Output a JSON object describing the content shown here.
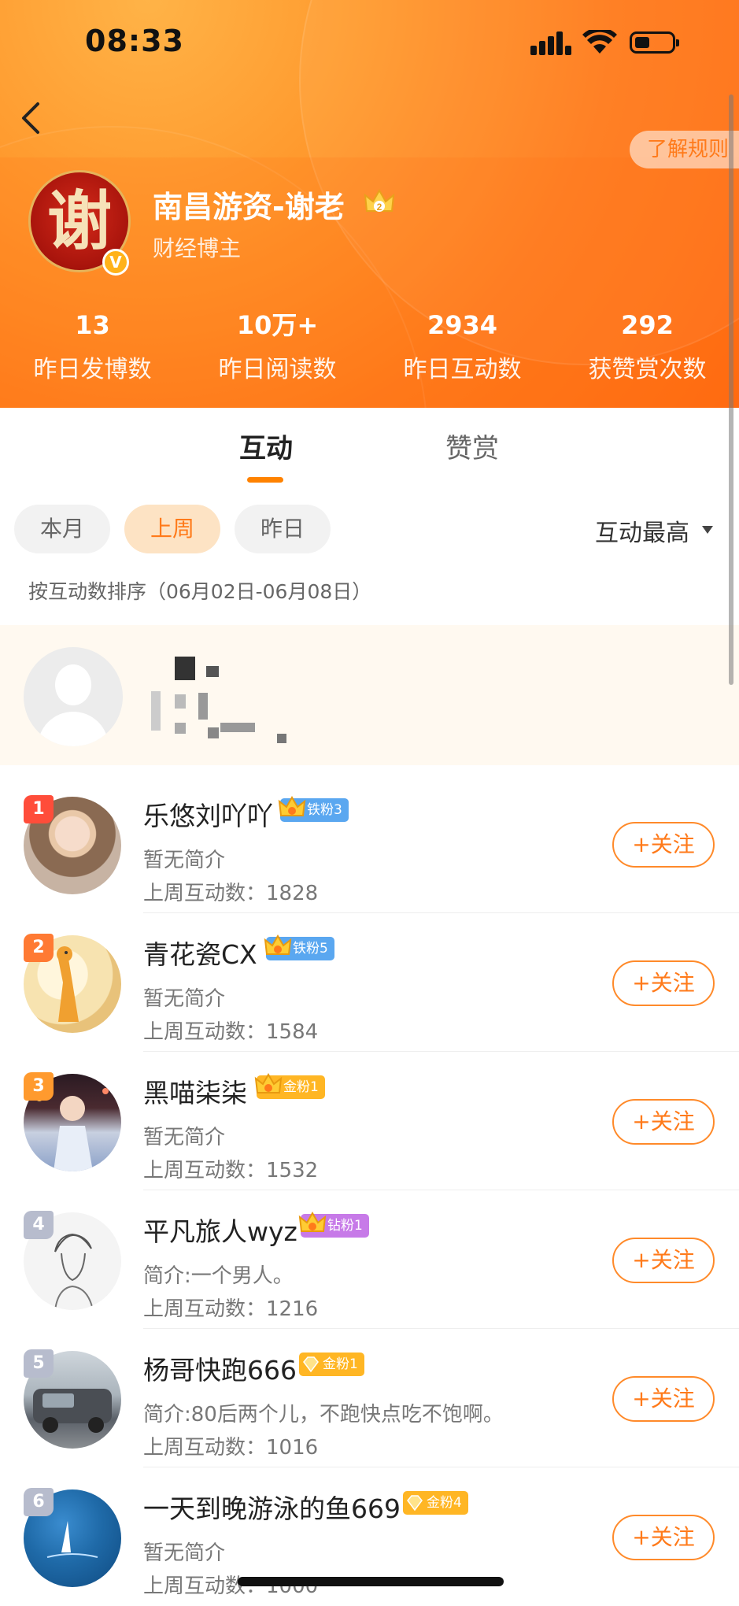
{
  "status_bar": {
    "time": "08:33"
  },
  "header": {
    "rules_button": "了解规则",
    "avatar_char": "谢",
    "user_name": "南昌游资-谢老",
    "user_subtitle": "财经博主",
    "stats": [
      {
        "value": "13",
        "label": "昨日发博数"
      },
      {
        "value": "10万+",
        "label": "昨日阅读数"
      },
      {
        "value": "2934",
        "label": "昨日互动数"
      },
      {
        "value": "292",
        "label": "获赞赏次数"
      }
    ]
  },
  "tabs": [
    {
      "label": "互动",
      "active": true
    },
    {
      "label": "赞赏",
      "active": false
    }
  ],
  "filters": {
    "chips": [
      {
        "label": "本月",
        "active": false
      },
      {
        "label": "上周",
        "active": true
      },
      {
        "label": "昨日",
        "active": false
      }
    ],
    "sort_label": "互动最高",
    "range_note": "按互动数排序（06月02日-06月08日）"
  },
  "list": [
    {
      "rank": "1",
      "name": "乐悠刘吖吖",
      "badge": "铁粉3",
      "intro": "暂无简介",
      "count": "上周互动数：1828",
      "follow": "+关注"
    },
    {
      "rank": "2",
      "name": "青花瓷CX",
      "badge": "铁粉5",
      "intro": "暂无简介",
      "count": "上周互动数：1584",
      "follow": "+关注"
    },
    {
      "rank": "3",
      "name": "黑喵柒柒",
      "badge": "金粉1",
      "intro": "暂无简介",
      "count": "上周互动数：1532",
      "follow": "+关注"
    },
    {
      "rank": "4",
      "name": "平凡旅人wyz",
      "badge": "钻粉1",
      "intro": "简介:一个男人。",
      "count": "上周互动数：1216",
      "follow": "+关注"
    },
    {
      "rank": "5",
      "name": "杨哥快跑666",
      "badge": "金粉1",
      "intro": "简介:80后两个儿，不跑快点吃不饱啊。",
      "count": "上周互动数：1016",
      "follow": "+关注"
    },
    {
      "rank": "6",
      "name": "一天到晚游泳的鱼669",
      "badge": "金粉4",
      "intro": "暂无简介",
      "count": "上周互动数：1000",
      "follow": "+关注"
    }
  ],
  "colors": {
    "accent": "#ff8200",
    "rank_top": [
      "#ff4d3a",
      "#ff7a33",
      "#ff9a2e"
    ],
    "rank_other": "#b7bccd",
    "badge_iron": "#5aa7f0",
    "badge_gold": "#ffb624",
    "badge_diamond": "#c77ae8"
  }
}
